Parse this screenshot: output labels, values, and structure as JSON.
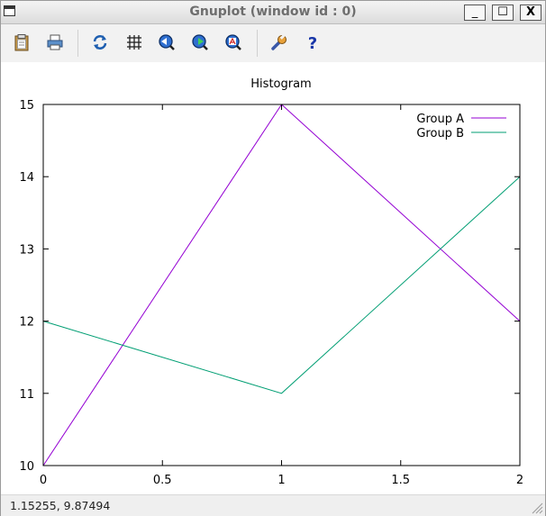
{
  "window": {
    "title": "Gnuplot (window id : 0)"
  },
  "window_buttons": {
    "minimize": "_",
    "maximize": "☐",
    "close": "X"
  },
  "toolbar": {
    "buttons": [
      "copy-to-clipboard",
      "print",
      "replot",
      "toggle-grid",
      "previous-zoom",
      "next-zoom",
      "autoscale",
      "options",
      "help"
    ]
  },
  "chart_data": {
    "type": "line",
    "title": "Histogram",
    "x": [
      0,
      1,
      2
    ],
    "series": [
      {
        "name": "Group A",
        "values": [
          10,
          15,
          12
        ],
        "color": "#9400d3"
      },
      {
        "name": "Group B",
        "values": [
          12,
          11,
          14
        ],
        "color": "#009e73"
      }
    ],
    "xlim": [
      0,
      2
    ],
    "ylim": [
      10,
      15
    ],
    "x_ticks": [
      0,
      0.5,
      1,
      1.5,
      2
    ],
    "x_tick_labels": [
      "0",
      "0.5",
      "1",
      "1.5",
      "2"
    ],
    "y_ticks": [
      10,
      11,
      12,
      13,
      14,
      15
    ],
    "y_tick_labels": [
      "10",
      "11",
      "12",
      "13",
      "14",
      "15"
    ],
    "grid": false,
    "legend_position": "top-right"
  },
  "status": {
    "coords": "1.15255,  9.87494"
  }
}
